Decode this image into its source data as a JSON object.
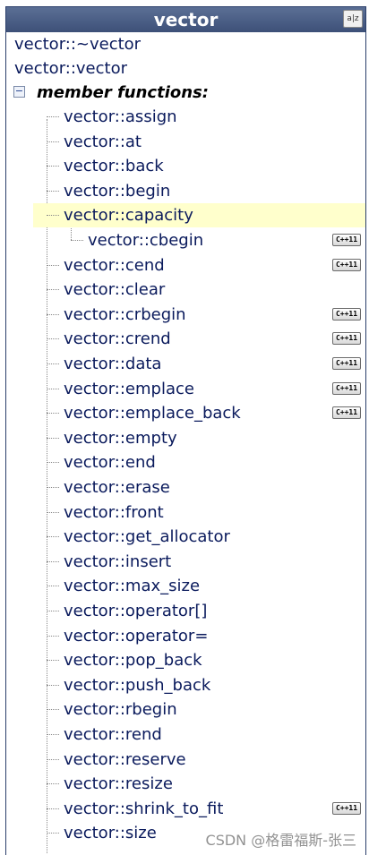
{
  "panel": {
    "title": "vector",
    "sort_button": "a|z"
  },
  "tree": {
    "top_items": [
      "vector::~vector",
      "vector::vector"
    ],
    "group_label": "member functions:",
    "group_toggle": "−",
    "members": [
      {
        "label": "vector::assign",
        "badge": ""
      },
      {
        "label": "vector::at",
        "badge": ""
      },
      {
        "label": "vector::back",
        "badge": ""
      },
      {
        "label": "vector::begin",
        "badge": ""
      },
      {
        "label": "vector::capacity",
        "badge": "",
        "selected": true
      },
      {
        "label": "vector::cbegin",
        "badge": "C++11",
        "nested": true
      },
      {
        "label": "vector::cend",
        "badge": "C++11"
      },
      {
        "label": "vector::clear",
        "badge": ""
      },
      {
        "label": "vector::crbegin",
        "badge": "C++11"
      },
      {
        "label": "vector::crend",
        "badge": "C++11"
      },
      {
        "label": "vector::data",
        "badge": "C++11"
      },
      {
        "label": "vector::emplace",
        "badge": "C++11"
      },
      {
        "label": "vector::emplace_back",
        "badge": "C++11"
      },
      {
        "label": "vector::empty",
        "badge": ""
      },
      {
        "label": "vector::end",
        "badge": ""
      },
      {
        "label": "vector::erase",
        "badge": ""
      },
      {
        "label": "vector::front",
        "badge": ""
      },
      {
        "label": "vector::get_allocator",
        "badge": ""
      },
      {
        "label": "vector::insert",
        "badge": ""
      },
      {
        "label": "vector::max_size",
        "badge": ""
      },
      {
        "label": "vector::operator[]",
        "badge": ""
      },
      {
        "label": "vector::operator=",
        "badge": ""
      },
      {
        "label": "vector::pop_back",
        "badge": ""
      },
      {
        "label": "vector::push_back",
        "badge": ""
      },
      {
        "label": "vector::rbegin",
        "badge": ""
      },
      {
        "label": "vector::rend",
        "badge": ""
      },
      {
        "label": "vector::reserve",
        "badge": ""
      },
      {
        "label": "vector::resize",
        "badge": ""
      },
      {
        "label": "vector::shrink_to_fit",
        "badge": "C++11"
      },
      {
        "label": "vector::size",
        "badge": ""
      }
    ]
  },
  "watermark": "CSDN @格雷福斯-张三"
}
